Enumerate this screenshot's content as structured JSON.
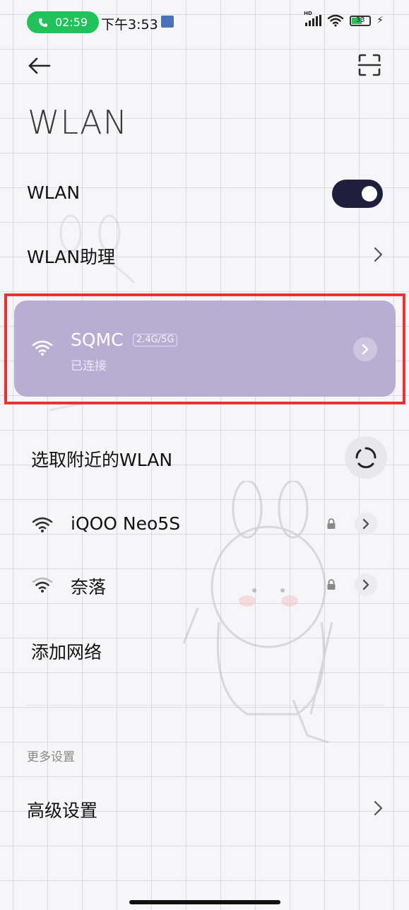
{
  "status_bar": {
    "call_time": "02:59",
    "clock": "下午3:53",
    "network_badge": "HD",
    "battery": "33"
  },
  "page": {
    "title": "WLAN"
  },
  "wlan_toggle": {
    "label": "WLAN",
    "enabled": true
  },
  "assistant": {
    "label": "WLAN助理"
  },
  "connected": {
    "ssid": "SQMC",
    "band": "2.4G/5G",
    "status": "已连接"
  },
  "nearby": {
    "title": "选取附近的WLAN",
    "networks": [
      {
        "name": "iQOO Neo5S",
        "locked": true
      },
      {
        "name": "奈落",
        "locked": true
      }
    ],
    "add_network": "添加网络"
  },
  "more": {
    "section_title": "更多设置",
    "advanced": "高级设置"
  },
  "colors": {
    "accent": "#1f1f3d",
    "card": "#b8aed3",
    "highlight": "#ee3030",
    "call_pill": "#22c25a"
  }
}
